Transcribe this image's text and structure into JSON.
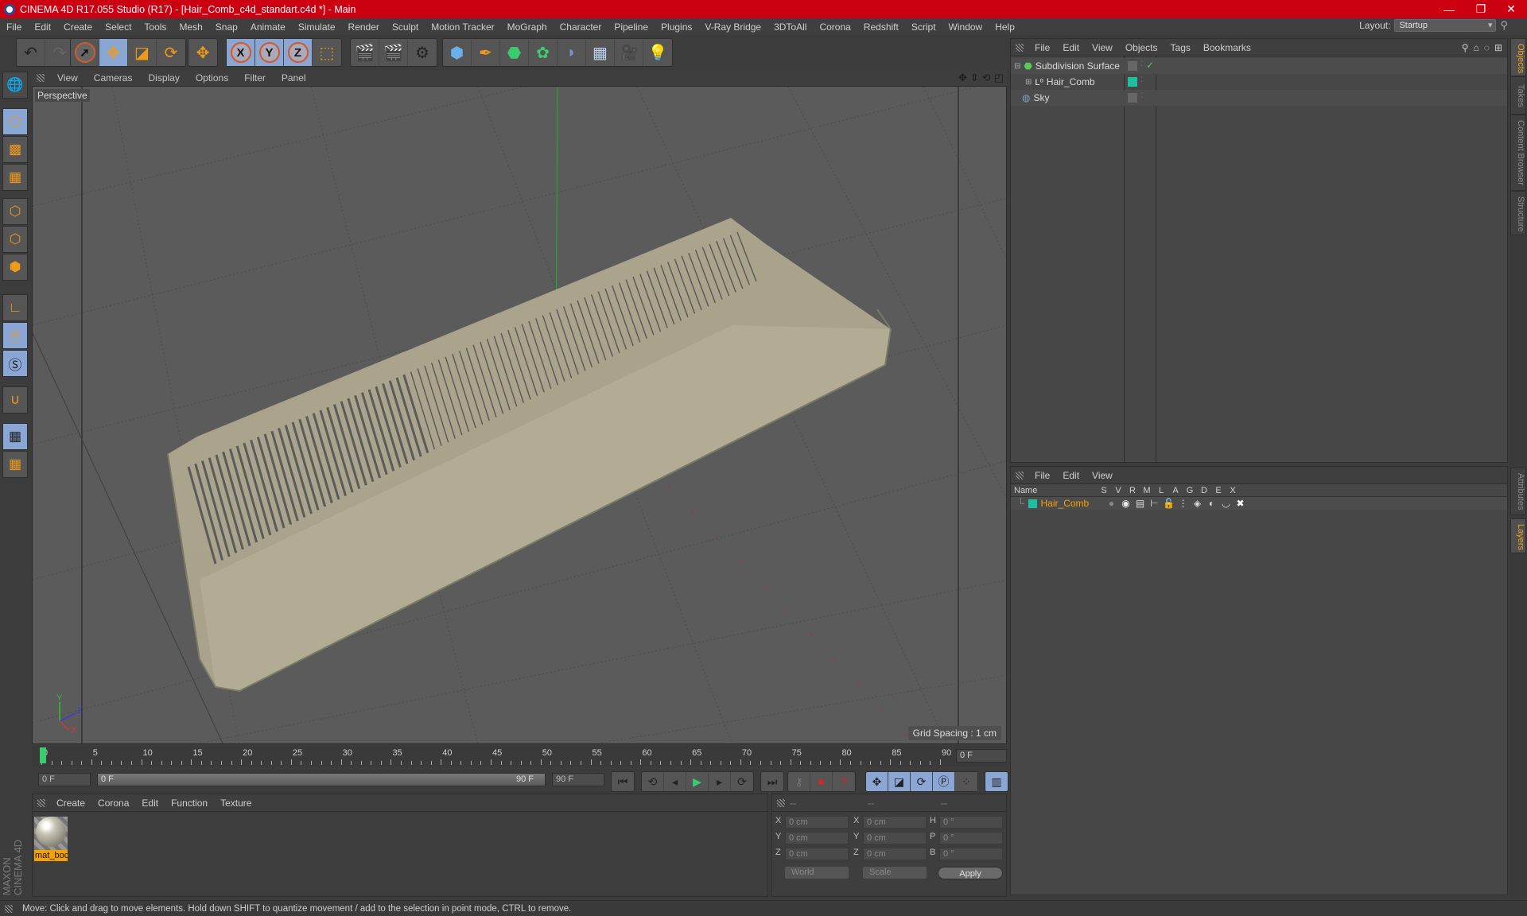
{
  "app": {
    "title": "CINEMA 4D R17.055 Studio (R17) - [Hair_Comb_c4d_standart.c4d *] - Main",
    "window_controls": {
      "minimize": "—",
      "maximize": "❐",
      "close": "✕"
    }
  },
  "menubar": [
    "File",
    "Edit",
    "Create",
    "Select",
    "Tools",
    "Mesh",
    "Snap",
    "Animate",
    "Simulate",
    "Render",
    "Sculpt",
    "Motion Tracker",
    "MoGraph",
    "Character",
    "Pipeline",
    "Plugins",
    "V-Ray Bridge",
    "3DToAll",
    "Corona",
    "Redshift",
    "Script",
    "Window",
    "Help"
  ],
  "layout": {
    "label": "Layout:",
    "value": "Startup"
  },
  "toolbar": {
    "history": [
      "undo-icon",
      "redo-icon"
    ],
    "modes": [
      "live-selection-icon",
      "move-icon",
      "scale-icon",
      "rotate-icon"
    ],
    "extra": [
      "recent-tool-icon"
    ],
    "axes": [
      "X",
      "Y",
      "Z",
      "coordinate-system-icon"
    ],
    "render": [
      "render-view-icon",
      "render-picture-viewer-icon",
      "render-settings-icon"
    ],
    "objects": [
      "cube-icon",
      "pen-icon",
      "subdivision-icon",
      "cloner-icon",
      "deformer-icon",
      "floor-icon",
      "camera-icon",
      "light-icon"
    ]
  },
  "left_tools": [
    "make-editable-icon",
    "model-mode-icon",
    "texture-mode-icon",
    "workplane-icon",
    "points-mode-icon",
    "edges-mode-icon",
    "polygons-mode-icon",
    "axis-icon",
    "tweak-icon",
    "snap-s-icon",
    "magnet-icon",
    "lock-workplane-icon",
    "workplane-cycle-icon"
  ],
  "viewport": {
    "menu": [
      "View",
      "Cameras",
      "Display",
      "Options",
      "Filter",
      "Panel"
    ],
    "camera_label": "Perspective",
    "grid_spacing": "Grid Spacing : 1 cm",
    "nav_icons": [
      "move-view-icon",
      "zoom-view-icon",
      "rotate-view-icon",
      "maximize-view-icon"
    ],
    "axis_labels": {
      "x": "X",
      "y": "Y",
      "z": "Z"
    }
  },
  "object_manager": {
    "menu": [
      "File",
      "Edit",
      "View",
      "Objects",
      "Tags",
      "Bookmarks"
    ],
    "objects": [
      {
        "name": "Subdivision Surface",
        "icon": "subdivision-icon",
        "tag": "check",
        "color": "#5ac85a"
      },
      {
        "name": "Hair_Comb",
        "icon": "null-icon",
        "tag": "layer",
        "color": "#1ec0a0"
      },
      {
        "name": "Sky",
        "icon": "sky-icon",
        "tag": "none",
        "color": "#7aa0d0"
      }
    ]
  },
  "side_tabs": {
    "top": [
      {
        "label": "Objects",
        "active": true
      },
      {
        "label": "Takes",
        "active": false
      },
      {
        "label": "Content Browser",
        "active": false
      },
      {
        "label": "Structure",
        "active": false
      }
    ],
    "bottom": [
      {
        "label": "Attributes",
        "active": false
      },
      {
        "label": "Layers",
        "active": true
      }
    ]
  },
  "layer_manager": {
    "menu": [
      "File",
      "Edit",
      "View"
    ],
    "columns": [
      "Name",
      "S",
      "V",
      "R",
      "M",
      "L",
      "A",
      "G",
      "D",
      "E",
      "X"
    ],
    "layers": [
      {
        "name": "Hair_Comb",
        "color": "#1ec0a0"
      }
    ]
  },
  "timeline": {
    "ticks": [
      0,
      5,
      10,
      15,
      20,
      25,
      30,
      35,
      40,
      45,
      50,
      55,
      60,
      65,
      70,
      75,
      80,
      85,
      90
    ],
    "current_frame": "0 F",
    "start_field": "0 F",
    "range_start": "0 F",
    "range_end": "90 F",
    "end_field": "90 F"
  },
  "transport": {
    "buttons": [
      "go-to-start-icon",
      "previous-key-icon",
      "previous-frame-icon",
      "play-icon",
      "next-frame-icon",
      "next-key-icon",
      "go-to-end-icon"
    ],
    "record": [
      "autokey-icon",
      "record-icon",
      "keyframe-help-icon"
    ],
    "key_modes": [
      "key-position-icon",
      "key-scale-icon",
      "key-rotation-icon",
      "key-parameter-icon",
      "key-pla-icon"
    ],
    "timeline_icon": "film-strip-icon"
  },
  "material_manager": {
    "menu": [
      "Create",
      "Corona",
      "Edit",
      "Function",
      "Texture"
    ],
    "materials": [
      {
        "name": "mat_bod"
      }
    ]
  },
  "coordinates": {
    "headers": [
      "--",
      "--",
      "--"
    ],
    "rows": [
      {
        "a": "X",
        "av": "0 cm",
        "b": "X",
        "bv": "0 cm",
        "c": "H",
        "cv": "0 °"
      },
      {
        "a": "Y",
        "av": "0 cm",
        "b": "Y",
        "bv": "0 cm",
        "c": "P",
        "cv": "0 °"
      },
      {
        "a": "Z",
        "av": "0 cm",
        "b": "Z",
        "bv": "0 cm",
        "c": "B",
        "cv": "0 °"
      }
    ],
    "space": "World",
    "mode": "Scale",
    "apply": "Apply"
  },
  "brand": "MAXON CINEMA 4D",
  "status": "Move: Click and drag to move elements. Hold down SHIFT to quantize movement / add to the selection in point mode, CTRL to remove."
}
